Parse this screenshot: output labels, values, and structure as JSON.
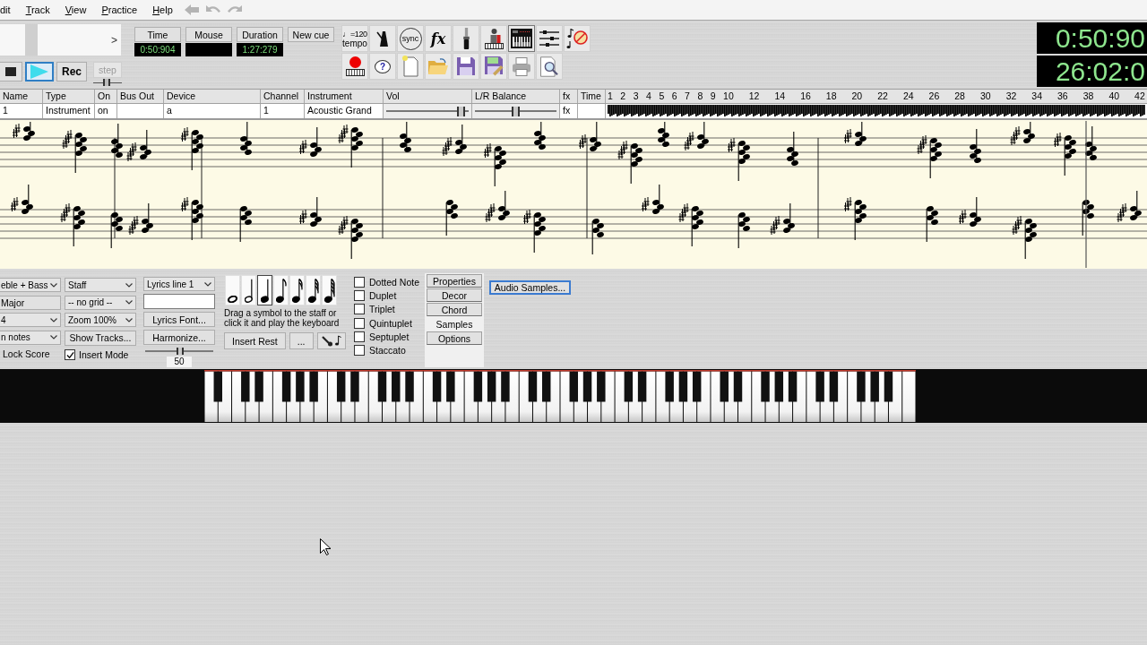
{
  "menu": {
    "items": [
      {
        "label": "dit",
        "underline_first": false
      },
      {
        "label": "Track",
        "underline_first": true
      },
      {
        "label": "View",
        "underline_first": true
      },
      {
        "label": "Practice",
        "underline_first": true
      },
      {
        "label": "Help",
        "underline_first": true
      }
    ],
    "history": [
      {
        "kind": "back",
        "disabled": true
      },
      {
        "kind": "undo",
        "disabled": true
      },
      {
        "kind": "redo",
        "disabled": true
      }
    ]
  },
  "position": {
    "arrow": ">"
  },
  "transport": [
    {
      "kind": "stop",
      "selected": false
    },
    {
      "kind": "play",
      "selected": true
    },
    {
      "kind": "record",
      "label": "Rec",
      "selected": false
    }
  ],
  "step": {
    "label": "step",
    "disabled": true,
    "level": 0.45
  },
  "counters": [
    {
      "label": "Time",
      "value": "0:50:904"
    },
    {
      "label": "Mouse"
    },
    {
      "label": "Duration",
      "value": "1:27:279"
    }
  ],
  "new_cue": "New cue",
  "toolbar": [
    {
      "kind": "tempo",
      "label": "♩=120",
      "sublabel": "tempo"
    },
    {
      "kind": "metronome"
    },
    {
      "kind": "sync",
      "label": "sync"
    },
    {
      "kind": "effects",
      "label": "fx"
    },
    {
      "kind": "jack"
    },
    {
      "kind": "player"
    },
    {
      "kind": "keyboard"
    },
    {
      "kind": "mixer"
    },
    {
      "kind": "mute"
    },
    {
      "kind": "record"
    },
    {
      "kind": "help",
      "label": "?"
    },
    {
      "kind": "new"
    },
    {
      "kind": "open"
    },
    {
      "kind": "save"
    },
    {
      "kind": "save_as"
    },
    {
      "kind": "print"
    },
    {
      "kind": "preview"
    }
  ],
  "clock": [
    "0:50:90",
    "26:02:0"
  ],
  "tracks": {
    "columns": [
      "Name",
      "Type",
      "On",
      "Bus Out",
      "Device",
      "Channel",
      "Instrument",
      "Vol",
      "L/R Balance",
      "fx",
      "Time"
    ],
    "measures": [
      "1",
      "2",
      "3",
      "4",
      "5",
      "6",
      "7",
      "8",
      "9",
      "10",
      "12",
      "14",
      "16",
      "18",
      "20",
      "22",
      "24",
      "26",
      "28",
      "30",
      "32",
      "34",
      "36",
      "38",
      "40",
      "42"
    ],
    "rows": [
      {
        "name": "1",
        "type": "Instrument",
        "on": "on",
        "device": "a",
        "channel": "1",
        "instrument": "Acoustic Grand",
        "vol": {
          "level": 0.95
        },
        "balance": {
          "level": 0.5
        },
        "fx": "fx"
      }
    ]
  },
  "controls": {
    "column_1": [
      {
        "kind": "dropdown",
        "value": "eble + Bass"
      },
      {
        "kind": "button",
        "label": "Major"
      },
      {
        "kind": "dropdown",
        "value": "4"
      },
      {
        "kind": "dropdown",
        "value": "n notes"
      },
      {
        "kind": "label",
        "label": "Lock Score"
      }
    ],
    "column_2": [
      {
        "kind": "dropdown",
        "value": "Staff"
      },
      {
        "kind": "dropdown",
        "value": "-- no grid --"
      },
      {
        "kind": "dropdown",
        "value": "Zoom 100%"
      },
      {
        "kind": "button",
        "label": "Show Tracks..."
      },
      {
        "kind": "checkbox",
        "label": "Insert Mode",
        "checked": true
      }
    ],
    "column_3": [
      {
        "kind": "dropdown",
        "value": "Lyrics line 1"
      },
      {
        "kind": "field"
      },
      {
        "kind": "button",
        "label": "Lyrics Font..."
      },
      {
        "kind": "button",
        "label": "Harmonize..."
      },
      {
        "kind": "slider",
        "level": 0.52,
        "reading": "50"
      }
    ],
    "note_palette": [
      {
        "kind": "whole",
        "selected": false
      },
      {
        "kind": "half",
        "selected": false
      },
      {
        "kind": "quarter",
        "selected": true
      },
      {
        "kind": "eighth",
        "selected": false
      },
      {
        "kind": "sixteenth",
        "selected": false
      },
      {
        "kind": "thirty-second",
        "selected": false
      },
      {
        "kind": "sixty-fourth",
        "selected": false
      }
    ],
    "palette_hint": "Drag a symbol to the staff or click it and play the keyboard",
    "palette_buttons": [
      {
        "kind": "text",
        "label": "Insert Rest"
      },
      {
        "kind": "text",
        "label": "..."
      },
      {
        "kind": "microphone"
      }
    ],
    "modifiers": [
      {
        "label": "Dotted Note",
        "checked": false
      },
      {
        "label": "Duplet",
        "checked": false
      },
      {
        "label": "Triplet",
        "checked": false
      },
      {
        "label": "Quintuplet",
        "checked": false
      },
      {
        "label": "Septuplet",
        "checked": false
      },
      {
        "label": "Staccato",
        "checked": false
      }
    ],
    "side_tabs": [
      {
        "label": "Properties",
        "selected": false
      },
      {
        "label": "Decor",
        "selected": false
      },
      {
        "label": "Chord",
        "selected": false
      },
      {
        "label": "Samples",
        "selected": true
      },
      {
        "label": "Options",
        "selected": false
      }
    ],
    "panel_button": "Audio Samples..."
  }
}
